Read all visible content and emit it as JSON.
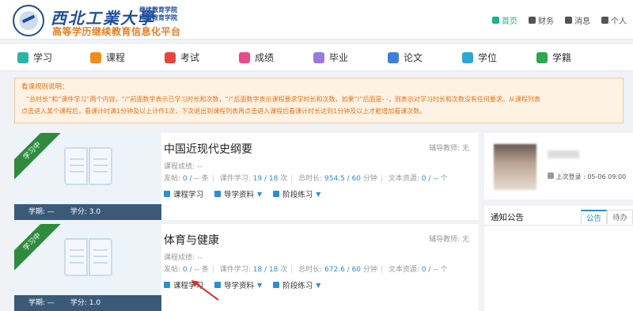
{
  "header": {
    "uni_name": "西北工業大學",
    "sub_a": "继续教育学院",
    "sub_b": "网络教育学院",
    "platform": "高等学历继续教育信息化平台",
    "links": [
      {
        "label": "首页",
        "icon": "home-icon"
      },
      {
        "label": "财务",
        "icon": "finance-icon"
      },
      {
        "label": "消息",
        "icon": "bell-icon"
      },
      {
        "label": "个人",
        "icon": "user-icon"
      }
    ]
  },
  "nav": [
    {
      "label": "学习",
      "icon": "study-icon",
      "color": "#26b5a7"
    },
    {
      "label": "课程",
      "icon": "course-icon",
      "color": "#f08c1d"
    },
    {
      "label": "考试",
      "icon": "exam-icon",
      "color": "#e8453c"
    },
    {
      "label": "成绩",
      "icon": "score-icon",
      "color": "#e84a8a"
    },
    {
      "label": "毕业",
      "icon": "graduate-icon",
      "color": "#9a7ae0"
    },
    {
      "label": "论文",
      "icon": "thesis-icon",
      "color": "#3e7fd8"
    },
    {
      "label": "学位",
      "icon": "degree-icon",
      "color": "#2fa6d6"
    },
    {
      "label": "学籍",
      "icon": "status-icon",
      "color": "#2ca84f"
    }
  ],
  "rules": {
    "title": "看课规则说明：",
    "line1": "“总时长”和“课件学习”两个内容，“/”前面数字表示已学习时长和次数，“/”后面数字表示课程要求学时长和次数，如果“/”后面是- -，则表示对学习时长和次数没有任何要求。从课程列表",
    "line2": "点击进入某个课程后，看课计时满1分钟及以上计作1次，下次退出到课程列表再点击进入课程后看课计时长达到1分钟及以上才能增加看课次数。"
  },
  "courses": [
    {
      "status": "学习中",
      "term": "学期: —",
      "credit": "学分: 3.0",
      "title": "中国近现代史纲要",
      "tutor": "辅导教师: 无",
      "grade": "课程成绩: --",
      "posts_label": "发帖:",
      "posts": "0 / --",
      "posts_unit": "条",
      "courseware_label": "课件学习:",
      "courseware": "19 / 18",
      "courseware_unit": "次",
      "duration_label": "总时长:",
      "duration": "954.5 / 60",
      "duration_unit": "分钟",
      "text_label": "文本资源:",
      "text": "0 / --",
      "text_unit": "个",
      "act1": "课程学习",
      "act2": "导学资料",
      "act3": "阶段练习"
    },
    {
      "status": "学习中",
      "term": "学期: —",
      "credit": "学分: 1.0",
      "title": "体育与健康",
      "tutor": "辅导教师: 无",
      "grade": "课程成绩: --",
      "posts_label": "发帖:",
      "posts": "0 / --",
      "posts_unit": "条",
      "courseware_label": "课件学习:",
      "courseware": "18 / 18",
      "courseware_unit": "次",
      "duration_label": "总时长:",
      "duration": "672.6 / 60",
      "duration_unit": "分钟",
      "text_label": "文本资源:",
      "text": "0 / --",
      "text_unit": "个",
      "act1": "课程学习",
      "act2": "导学资料",
      "act3": "阶段练习"
    }
  ],
  "profile": {
    "last_login": "上次登录 : 05-06 09:00"
  },
  "notice": {
    "title": "通知公告",
    "tabs": [
      "公告",
      "待办"
    ]
  }
}
